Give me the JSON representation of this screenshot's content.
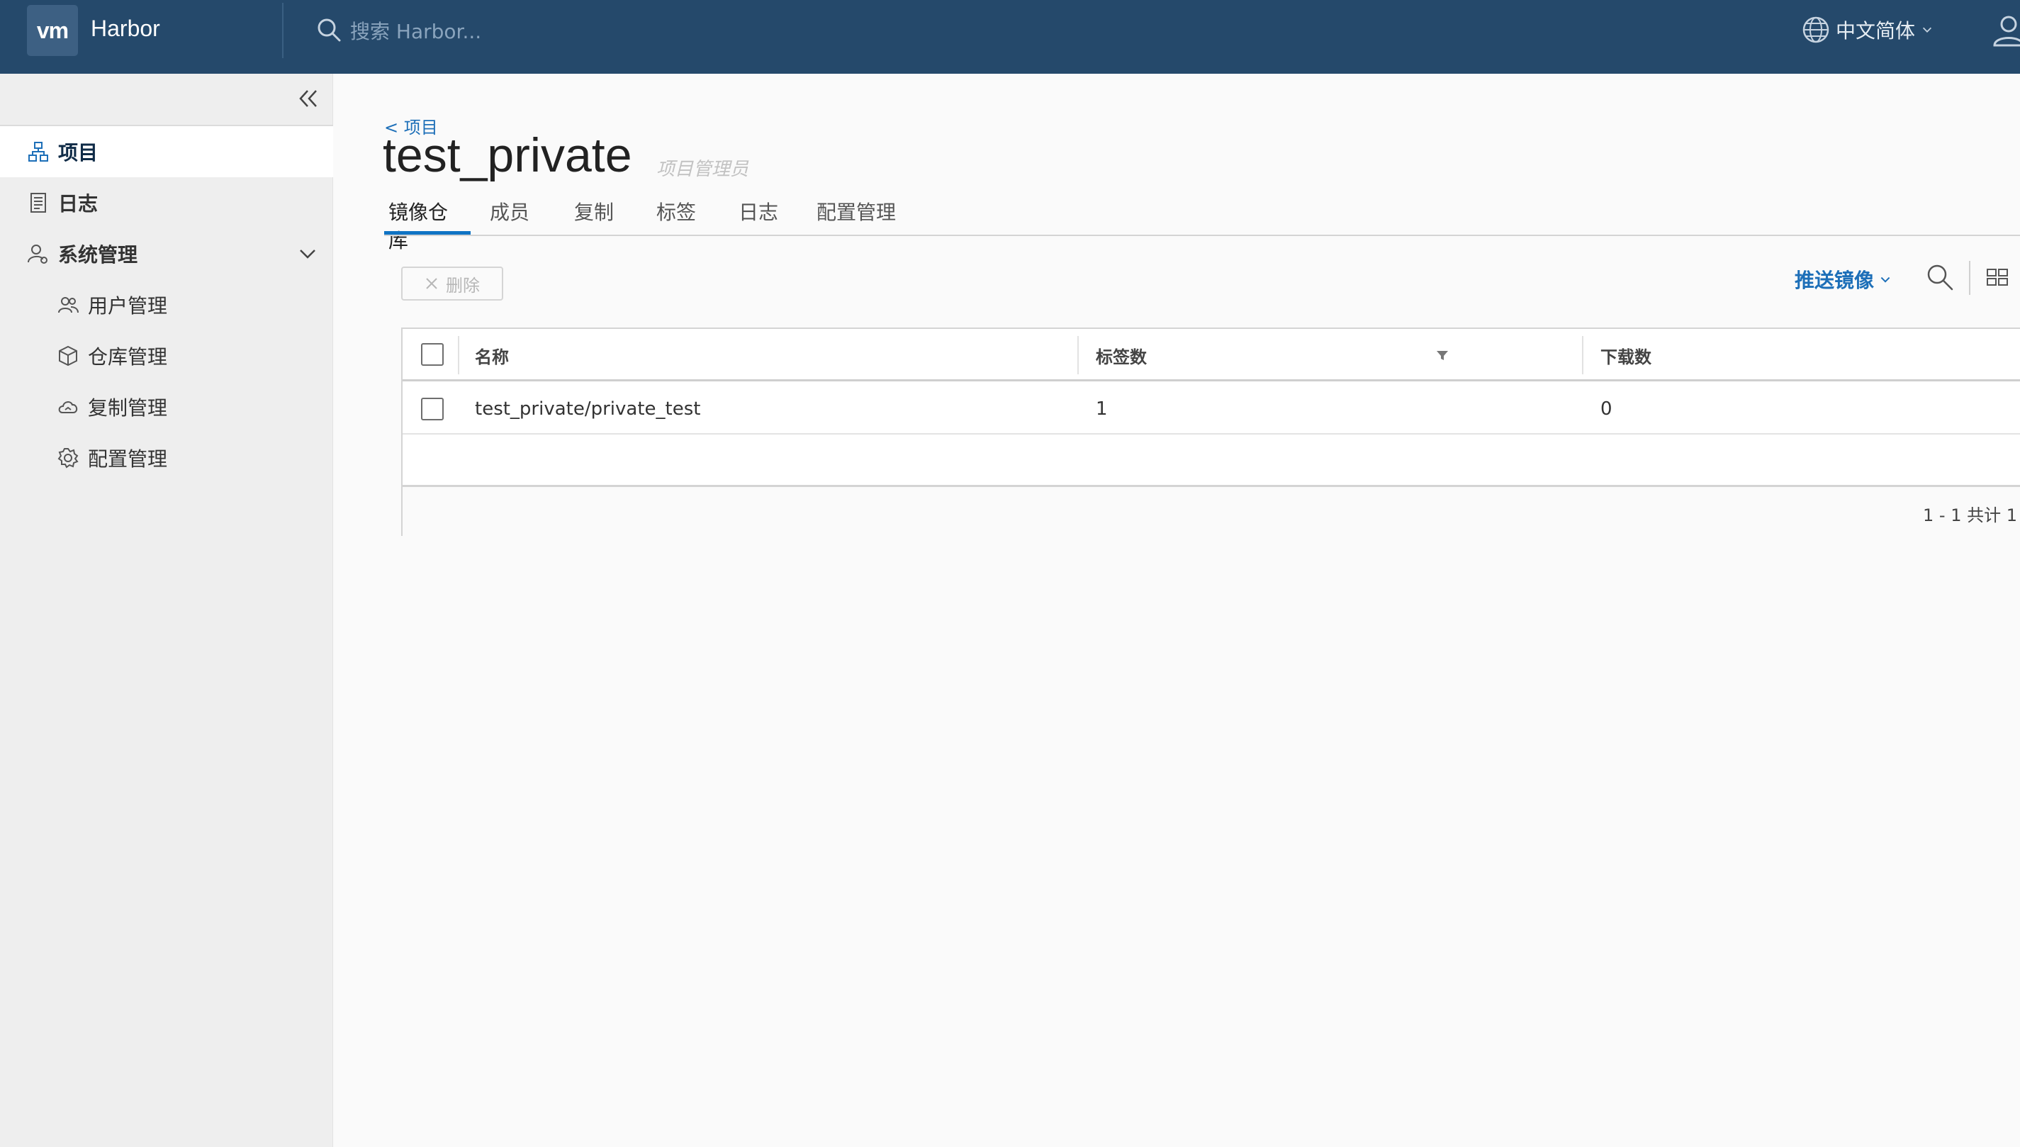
{
  "header": {
    "logo_text": "vm",
    "app_name": "Harbor",
    "search_placeholder": "搜索 Harbor...",
    "language": "中文简体"
  },
  "sidebar": {
    "items": [
      {
        "label": "项目",
        "icon": "projects-icon",
        "active": true
      },
      {
        "label": "日志",
        "icon": "logs-icon"
      },
      {
        "label": "系统管理",
        "icon": "admin-icon",
        "expanded": true
      },
      {
        "label": "用户管理",
        "icon": "users-icon"
      },
      {
        "label": "仓库管理",
        "icon": "registry-icon"
      },
      {
        "label": "复制管理",
        "icon": "replication-icon"
      },
      {
        "label": "配置管理",
        "icon": "settings-icon"
      }
    ]
  },
  "main": {
    "breadcrumb": "< 项目",
    "title": "test_private",
    "role": "项目管理员",
    "tabs": [
      {
        "label": "镜像仓库",
        "active": true
      },
      {
        "label": "成员"
      },
      {
        "label": "复制"
      },
      {
        "label": "标签"
      },
      {
        "label": "日志"
      },
      {
        "label": "配置管理"
      }
    ],
    "toolbar": {
      "delete_label": "删除",
      "push_label": "推送镜像"
    },
    "table": {
      "columns": [
        "名称",
        "标签数",
        "下载数"
      ],
      "rows": [
        {
          "name": "test_private/private_test",
          "tags": "1",
          "pulls": "0"
        }
      ],
      "pagination": "1 - 1 共计 1"
    }
  },
  "colors": {
    "header_bg": "#25496b",
    "accent": "#1d6fb8",
    "tab_underline": "#0f73c4"
  }
}
